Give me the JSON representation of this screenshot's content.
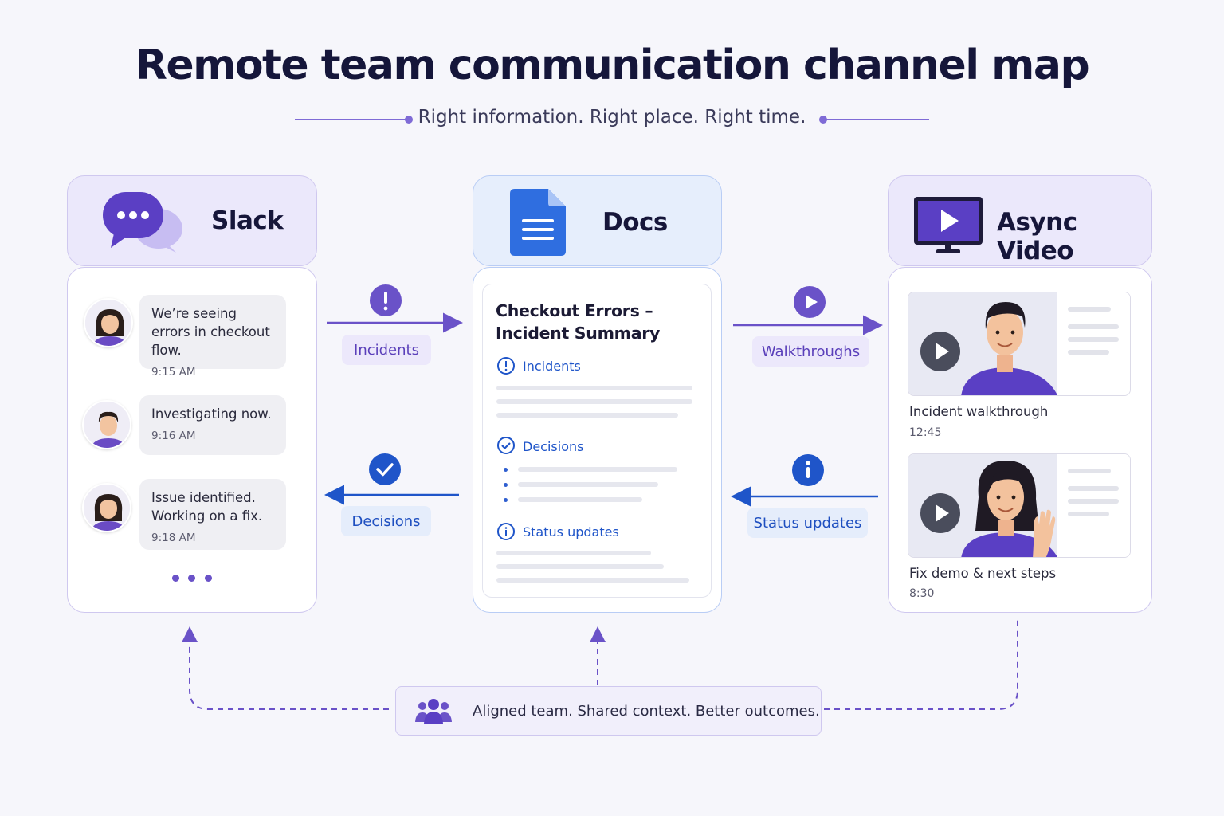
{
  "title": "Remote team communication channel map",
  "subtitle": "Right information. Right place. Right time.",
  "colors": {
    "purple": "#6a52c8",
    "blue": "#1f55c9",
    "ink": "#15163a"
  },
  "channels": {
    "slack": {
      "label": "Slack",
      "icon": "chat-bubbles-icon",
      "messages": [
        {
          "text": "We’re seeing errors in checkout flow.",
          "time": "9:15 AM"
        },
        {
          "text": "Investigating now.",
          "time": "9:16 AM"
        },
        {
          "text": "Issue identified. Working on a fix.",
          "time": "9:18 AM"
        }
      ]
    },
    "docs": {
      "label": "Docs",
      "icon": "document-icon",
      "doc_title": "Checkout Errors – Incident Summary",
      "sections": [
        {
          "label": "Incidents",
          "icon": "alert-circle-icon"
        },
        {
          "label": "Decisions",
          "icon": "check-circle-icon"
        },
        {
          "label": "Status updates",
          "icon": "info-circle-icon"
        }
      ]
    },
    "video": {
      "label": "Async Video",
      "icon": "monitor-play-icon",
      "videos": [
        {
          "title": "Incident walkthrough",
          "duration": "12:45"
        },
        {
          "title": "Fix demo & next steps",
          "duration": "8:30"
        }
      ]
    }
  },
  "flows": {
    "slack_to_docs": {
      "label": "Incidents",
      "icon": "exclamation-icon"
    },
    "docs_to_slack": {
      "label": "Decisions",
      "icon": "checkmark-icon"
    },
    "docs_to_video": {
      "label": "Walkthroughs",
      "icon": "play-icon"
    },
    "video_to_docs": {
      "label": "Status updates",
      "icon": "info-icon"
    }
  },
  "footer": {
    "text": "Aligned team. Shared context. Better outcomes.",
    "icon": "team-icon"
  }
}
